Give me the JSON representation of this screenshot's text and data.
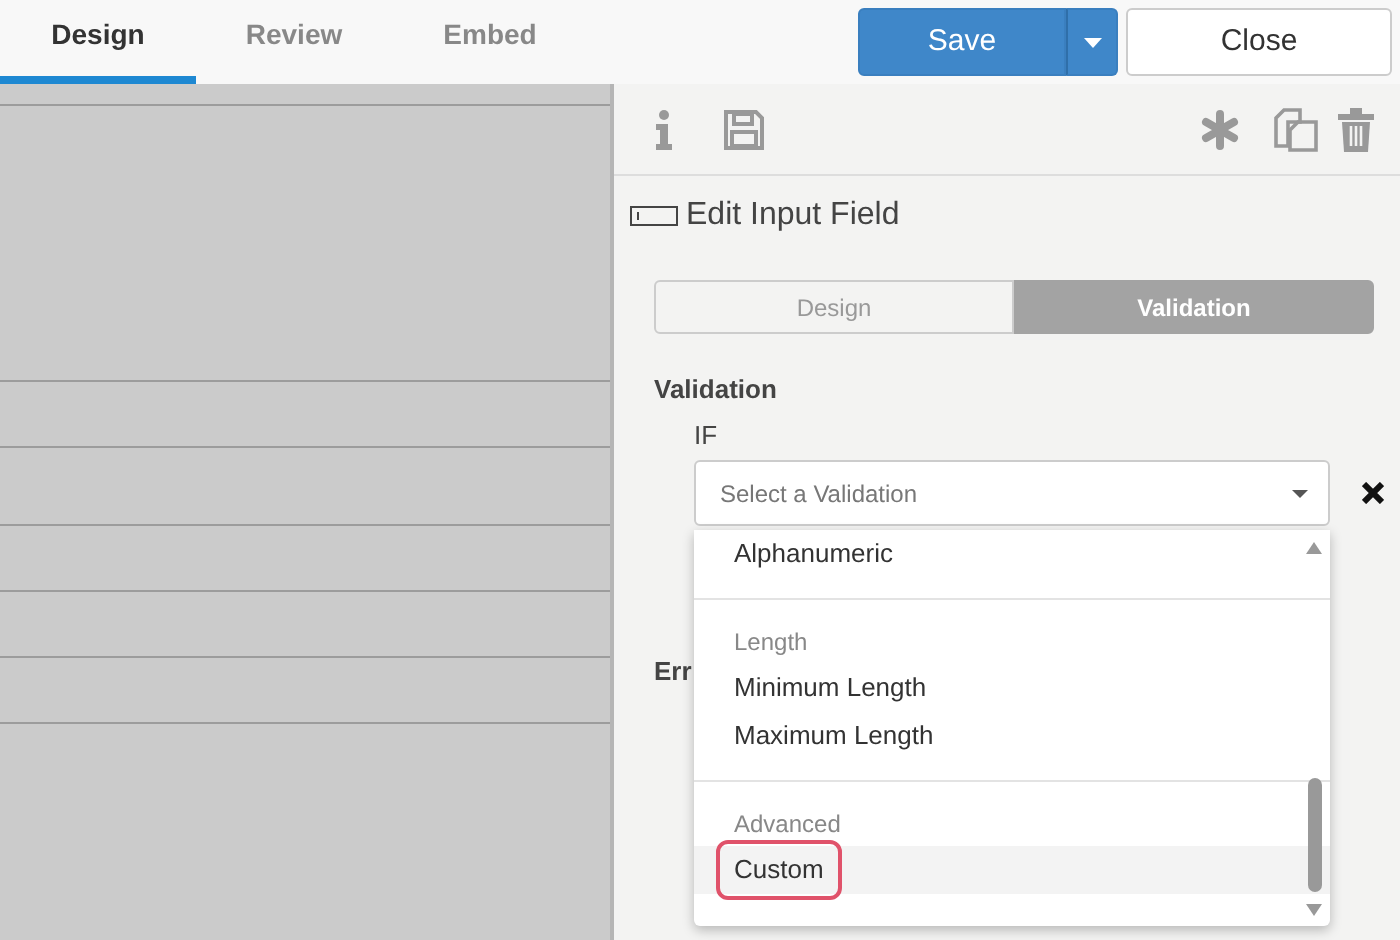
{
  "top_tabs": [
    {
      "label": "Design",
      "selected": true
    },
    {
      "label": "Review",
      "selected": false
    },
    {
      "label": "Embed",
      "selected": false
    }
  ],
  "save_button": {
    "label": "Save"
  },
  "close_button": {
    "label": "Close"
  },
  "panel": {
    "title": "Edit Input Field",
    "mode_tabs": [
      {
        "label": "Design",
        "selected": false
      },
      {
        "label": "Validation",
        "selected": true
      }
    ],
    "section_label": "Validation",
    "condition_label": "IF",
    "select": {
      "placeholder": "Select a Validation"
    },
    "error_label": "Err",
    "menu": [
      {
        "kind": "option",
        "label": "Alphanumeric",
        "selected": false
      },
      {
        "kind": "divider"
      },
      {
        "kind": "header",
        "label": "Length"
      },
      {
        "kind": "option",
        "label": "Minimum Length",
        "selected": false
      },
      {
        "kind": "option",
        "label": "Maximum Length",
        "selected": false
      },
      {
        "kind": "divider"
      },
      {
        "kind": "header",
        "label": "Advanced"
      },
      {
        "kind": "option",
        "label": "Custom",
        "selected": true
      }
    ]
  }
}
